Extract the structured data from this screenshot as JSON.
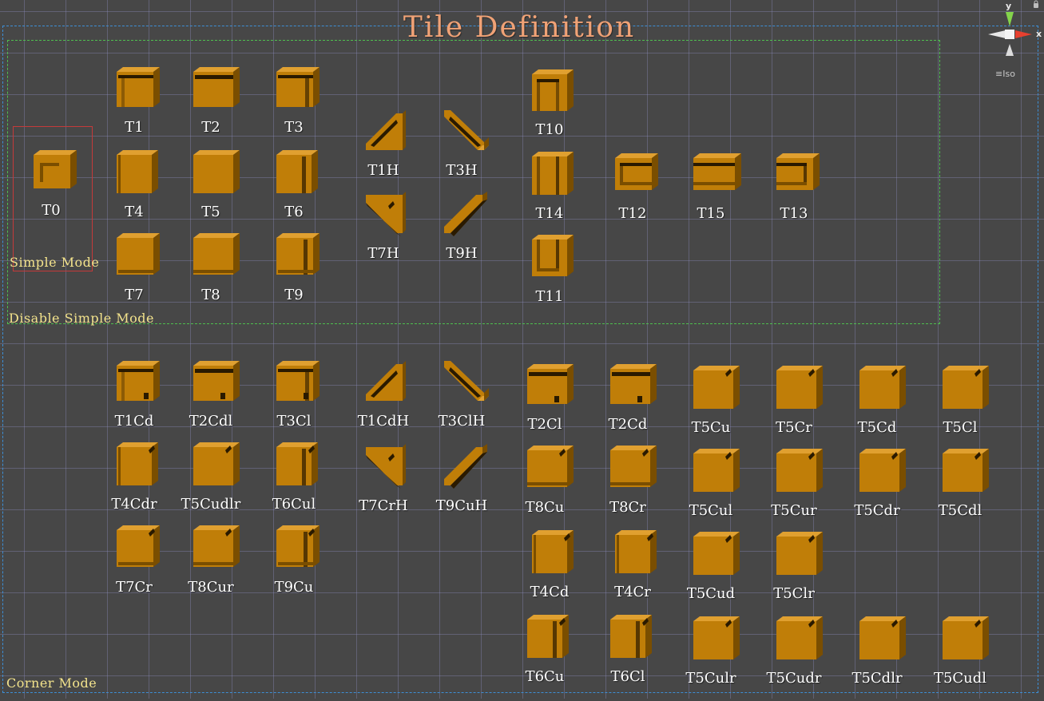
{
  "scene": {
    "title": "Tile Definition",
    "view_mode": "Iso",
    "gizmo_axes": {
      "y": "y",
      "x": "x"
    },
    "colors": {
      "background": "#474747",
      "tile_face": "#c07e08",
      "tile_side": "#7a4e00",
      "tile_top": "#e0a030",
      "title": "#f0a276",
      "mode_label": "#f3e38c"
    }
  },
  "modes": {
    "simple": "Simple Mode",
    "disable_simple": "Disable Simple Mode",
    "corner": "Corner Mode"
  },
  "tiles": [
    {
      "label": "T0",
      "shape": "frame-small"
    },
    {
      "label": "T1",
      "shape": "corner-tl"
    },
    {
      "label": "T2",
      "shape": "edge-top"
    },
    {
      "label": "T3",
      "shape": "corner-tr"
    },
    {
      "label": "T4",
      "shape": "edge-left"
    },
    {
      "label": "T5",
      "shape": "full"
    },
    {
      "label": "T6",
      "shape": "edge-right"
    },
    {
      "label": "T7",
      "shape": "corner-bl"
    },
    {
      "label": "T8",
      "shape": "edge-bottom"
    },
    {
      "label": "T9",
      "shape": "corner-br"
    },
    {
      "label": "T1H",
      "shape": "diag-tl"
    },
    {
      "label": "T3H",
      "shape": "diag-tr"
    },
    {
      "label": "T7H",
      "shape": "diag-bl"
    },
    {
      "label": "T9H",
      "shape": "diag-br"
    },
    {
      "label": "T10",
      "shape": "cap-top"
    },
    {
      "label": "T14",
      "shape": "vertical"
    },
    {
      "label": "T11",
      "shape": "cap-bottom"
    },
    {
      "label": "T12",
      "shape": "cap-left"
    },
    {
      "label": "T15",
      "shape": "horizontal"
    },
    {
      "label": "T13",
      "shape": "cap-right"
    },
    {
      "label": "T1Cd",
      "shape": "corner-tl-notch"
    },
    {
      "label": "T2Cdl",
      "shape": "edge-top-notch"
    },
    {
      "label": "T3Cl",
      "shape": "corner-tr-notch"
    },
    {
      "label": "T1CdH",
      "shape": "diag-tl"
    },
    {
      "label": "T3ClH",
      "shape": "diag-tr"
    },
    {
      "label": "T2Cl",
      "shape": "edge-top-notch"
    },
    {
      "label": "T2Cd",
      "shape": "edge-top-notch"
    },
    {
      "label": "T5Cu",
      "shape": "full-notch"
    },
    {
      "label": "T5Cr",
      "shape": "full-notch"
    },
    {
      "label": "T5Cd",
      "shape": "full-notch"
    },
    {
      "label": "T5Cl",
      "shape": "full-notch"
    },
    {
      "label": "T4Cdr",
      "shape": "edge-left-notch"
    },
    {
      "label": "T5Cudlr",
      "shape": "full-notch"
    },
    {
      "label": "T6Cul",
      "shape": "edge-right-notch"
    },
    {
      "label": "T7CrH",
      "shape": "diag-bl"
    },
    {
      "label": "T9CuH",
      "shape": "diag-br"
    },
    {
      "label": "T8Cu",
      "shape": "edge-bottom-notch"
    },
    {
      "label": "T8Cr",
      "shape": "edge-bottom-notch"
    },
    {
      "label": "T5Cul",
      "shape": "full-notch"
    },
    {
      "label": "T5Cur",
      "shape": "full-notch"
    },
    {
      "label": "T5Cdr",
      "shape": "full-notch"
    },
    {
      "label": "T5Cdl",
      "shape": "full-notch"
    },
    {
      "label": "T7Cr",
      "shape": "corner-bl-notch"
    },
    {
      "label": "T8Cur",
      "shape": "edge-bottom-notch"
    },
    {
      "label": "T9Cu",
      "shape": "corner-br-notch"
    },
    {
      "label": "T4Cd",
      "shape": "edge-left-notch"
    },
    {
      "label": "T4Cr",
      "shape": "edge-left-notch"
    },
    {
      "label": "T5Cud",
      "shape": "full-notch"
    },
    {
      "label": "T5Clr",
      "shape": "full-notch"
    },
    {
      "label": "T6Cu",
      "shape": "edge-right-notch"
    },
    {
      "label": "T6Cl",
      "shape": "edge-right-notch"
    },
    {
      "label": "T5Culr",
      "shape": "full-notch"
    },
    {
      "label": "T5Cudr",
      "shape": "full-notch"
    },
    {
      "label": "T5Cdlr",
      "shape": "full-notch"
    },
    {
      "label": "T5Cudl",
      "shape": "full-notch"
    }
  ]
}
